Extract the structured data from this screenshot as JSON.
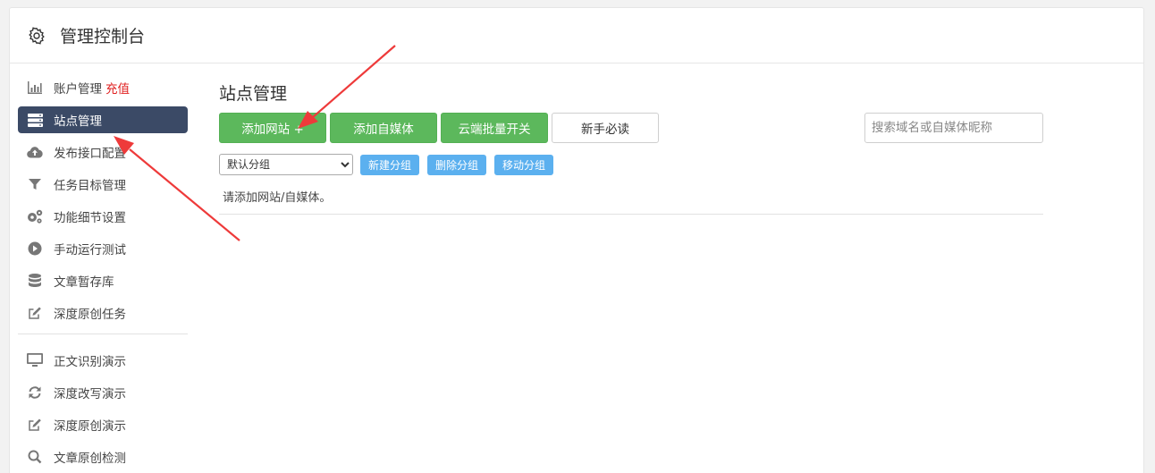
{
  "header": {
    "title": "管理控制台",
    "icon": "gear-icon"
  },
  "sidebar": {
    "items": [
      {
        "label": "账户管理",
        "badge": "充值",
        "icon": "bar-chart-icon"
      },
      {
        "label": "站点管理",
        "icon": "server-icon",
        "active": true
      },
      {
        "label": "发布接口配置",
        "icon": "cloud-upload-icon"
      },
      {
        "label": "任务目标管理",
        "icon": "filter-icon"
      },
      {
        "label": "功能细节设置",
        "icon": "gears-icon"
      },
      {
        "label": "手动运行测试",
        "icon": "play-circle-icon"
      },
      {
        "label": "文章暂存库",
        "icon": "database-icon"
      },
      {
        "label": "深度原创任务",
        "icon": "edit-icon"
      }
    ],
    "items2": [
      {
        "label": "正文识别演示",
        "icon": "monitor-icon"
      },
      {
        "label": "深度改写演示",
        "icon": "refresh-icon"
      },
      {
        "label": "深度原创演示",
        "icon": "edit-icon"
      },
      {
        "label": "文章原创检测",
        "icon": "search-icon"
      }
    ]
  },
  "main": {
    "title": "站点管理",
    "buttons": {
      "add_site": "添加网站 +",
      "add_media": "添加自媒体",
      "cloud_batch": "云端批量开关",
      "guide": "新手必读"
    },
    "search_placeholder": "搜索域名或自媒体昵称",
    "group": {
      "selected": "默认分组",
      "new": "新建分组",
      "delete": "删除分组",
      "move": "移动分组"
    },
    "empty_message": "请添加网站/自媒体。"
  },
  "colors": {
    "active_nav": "#3b4a66",
    "green": "#5cb85c",
    "blue": "#5bb0ef",
    "badge": "#e02020",
    "arrow": "#ee3a3a"
  }
}
